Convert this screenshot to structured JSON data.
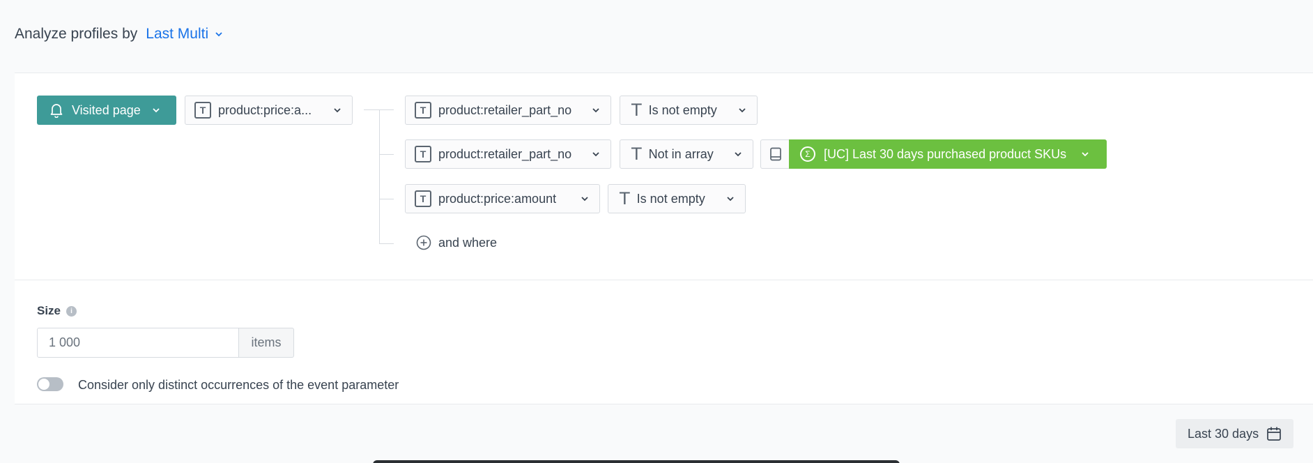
{
  "header": {
    "lead": "Analyze profiles by",
    "aggregate_select": "Last Multi"
  },
  "event": {
    "label": "Visited page",
    "icon": "bell-icon",
    "param": "product:price:a..."
  },
  "conditions": [
    {
      "param": "product:retailer_part_no",
      "operator": "Is not empty"
    },
    {
      "param": "product:retailer_part_no",
      "operator": "Not in array",
      "value": "[UC] Last 30 days purchased product SKUs"
    },
    {
      "param": "product:price:amount",
      "operator": "Is not empty"
    }
  ],
  "and_where": "and where",
  "size": {
    "label": "Size",
    "value": "1 000",
    "suffix": "items"
  },
  "distinct_toggle": {
    "label": "Consider only distinct occurrences of the event parameter",
    "on": false
  },
  "date_range": {
    "label": "Last 30 days"
  },
  "colors": {
    "event_button": "#3e9b98",
    "value_button": "#6cc040",
    "accent_link": "#1a73e8"
  }
}
